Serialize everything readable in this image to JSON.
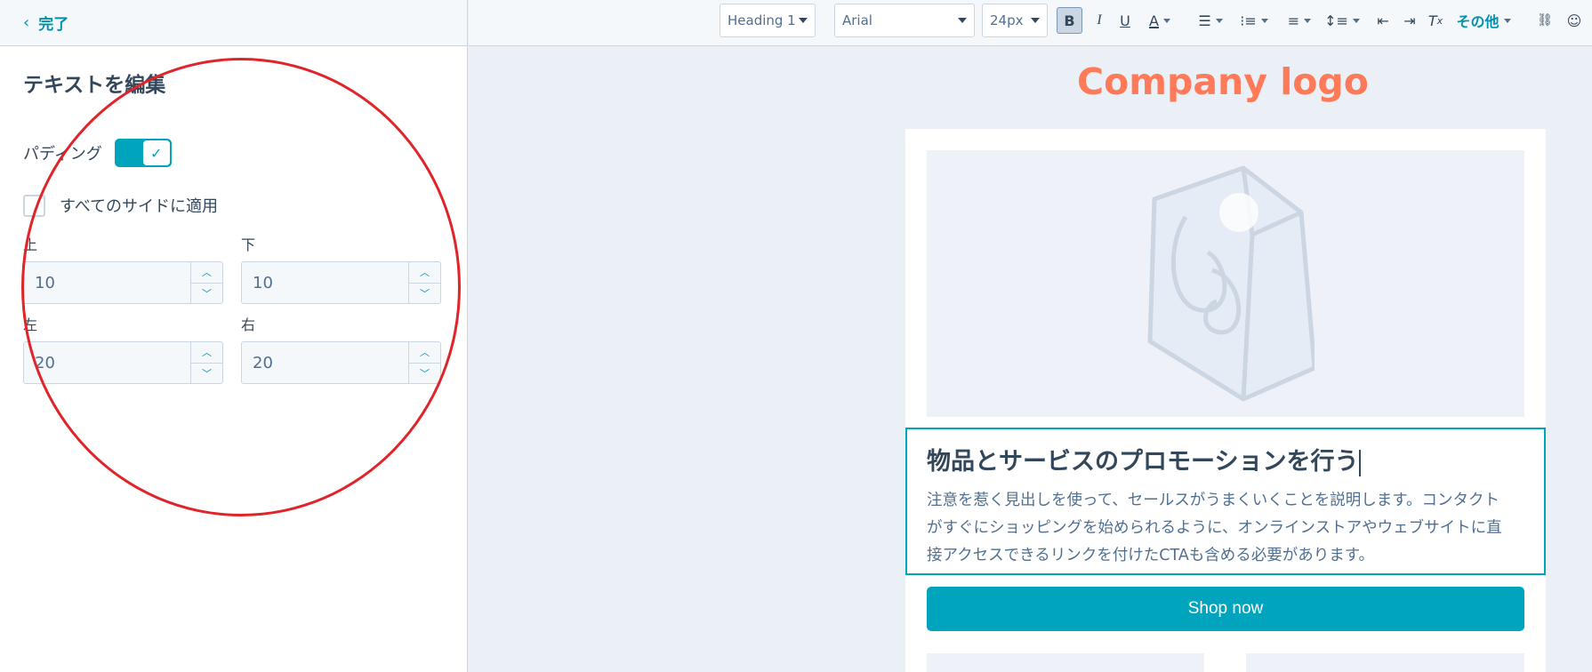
{
  "sidebar": {
    "back_label": "完了",
    "title": "テキストを編集",
    "padding_label": "パディング",
    "padding_enabled": true,
    "apply_all_label": "すべてのサイドに適用",
    "apply_all_checked": false,
    "fields": {
      "top": {
        "label": "上",
        "value": "10"
      },
      "bottom": {
        "label": "下",
        "value": "10"
      },
      "left": {
        "label": "左",
        "value": "20"
      },
      "right": {
        "label": "右",
        "value": "20"
      }
    }
  },
  "toolbar": {
    "style": "Heading 1",
    "font": "Arial",
    "size": "24px",
    "bold": "B",
    "italic": "I",
    "underline": "U",
    "text_color": "A",
    "clear_format": "T",
    "more": "その他"
  },
  "email": {
    "logo": "Company logo",
    "heading": "物品とサービスのプロモーションを行う",
    "body_lines": [
      "注意を惹く見出しを使って、セールスがうまくいくことを説明します。コンタクト",
      "がすぐにショッピングを始められるように、オンラインストアやウェブサイトに直",
      "接アクセスできるリンクを付けたCTAも含める必要があります。"
    ],
    "cta": "Shop now"
  },
  "colors": {
    "accent": "#00a4bd",
    "logo": "#ff7a59",
    "annotation": "#e0242a"
  }
}
